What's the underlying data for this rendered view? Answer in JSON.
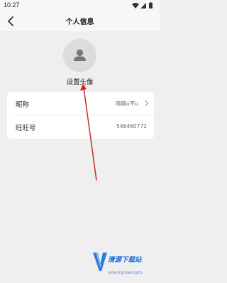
{
  "status_bar": {
    "time": "10:27",
    "icons": [
      "wifi-icon",
      "signal-icon",
      "battery-icon"
    ]
  },
  "header": {
    "title": "个人信息",
    "back_icon": "back-chevron-icon"
  },
  "avatar": {
    "caption": "设置头像",
    "icon": "user-placeholder-icon"
  },
  "info_rows": [
    {
      "label": "昵称",
      "value": "嘻嘻u不u",
      "has_chevron": true
    },
    {
      "label": "旺旺号",
      "value": "546460772",
      "has_chevron": false
    }
  ],
  "watermark": {
    "name": "清源下载站",
    "url": "www.fcytmeit.com"
  },
  "colors": {
    "background": "#efefef",
    "card": "#ffffff",
    "annotation_arrow": "#d0262a",
    "watermark": "#1a6fd6"
  }
}
